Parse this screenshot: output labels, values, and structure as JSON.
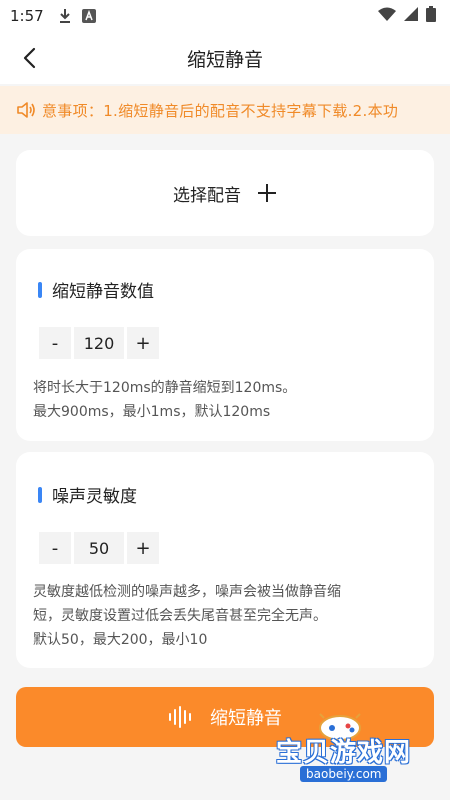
{
  "status_bar": {
    "time": "1:57",
    "icons": [
      "download-icon",
      "a-badge-icon",
      "wifi-icon",
      "signal-icon",
      "battery-icon"
    ]
  },
  "header": {
    "title": "缩短静音",
    "back_icon": "chevron-left-icon"
  },
  "notice": {
    "icon": "speaker-icon",
    "text": "意事项：1.缩短静音后的配音不支持字幕下载.2.本功"
  },
  "select_dub": {
    "label": "选择配音",
    "icon": "plus-icon"
  },
  "silence_section": {
    "title": "缩短静音数值",
    "minus_label": "-",
    "value": "120",
    "plus_label": "+",
    "desc_line1": "将时长大于120ms的静音缩短到120ms。",
    "desc_line2": "最大900ms，最小1ms，默认120ms"
  },
  "noise_section": {
    "title": "噪声灵敏度",
    "minus_label": "-",
    "value": "50",
    "plus_label": "+",
    "desc_line1": "灵敏度越低检测的噪声越多，噪声会被当做静音缩",
    "desc_line2": "短，灵敏度设置过低会丢失尾音甚至完全无声。",
    "desc_line3": "默认50，最大200，最小10"
  },
  "action_button": {
    "label": "缩短静音",
    "icon": "waveform-icon"
  },
  "watermark": {
    "text": "宝贝游戏网",
    "url": "baobeiy.com"
  },
  "colors": {
    "accent": "#fb8a2a",
    "notice_bg": "#fdf0e2",
    "notice_text": "#f08a28",
    "title_bar": "#3a86f5"
  }
}
